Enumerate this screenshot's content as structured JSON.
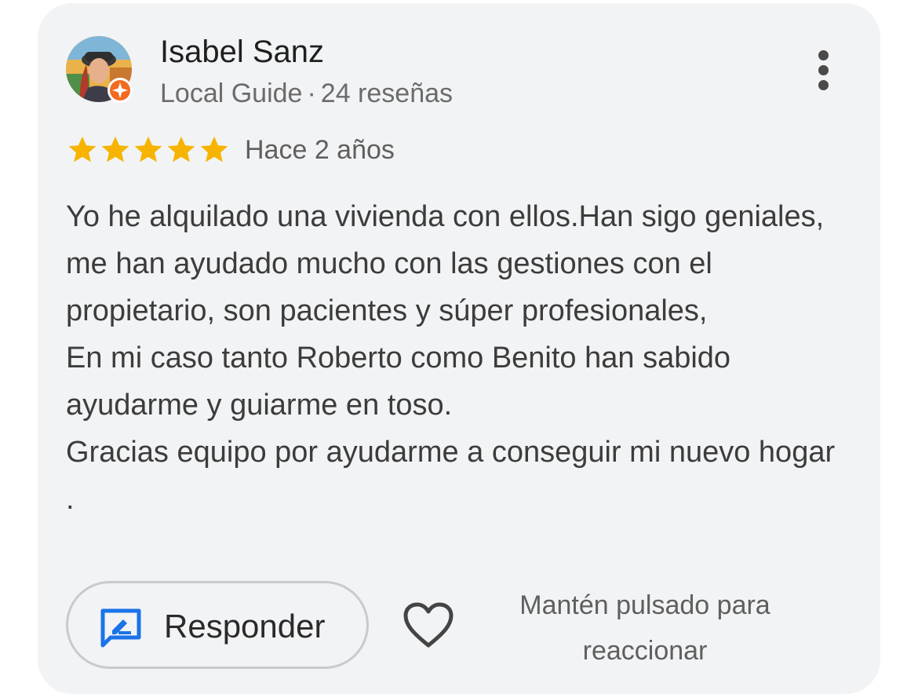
{
  "review": {
    "author": {
      "name": "Isabel Sanz",
      "badge": "Local Guide",
      "separator": "·",
      "review_count": "24 reseñas",
      "avatar_icon": "user-avatar-illustration",
      "guide_badge_icon": "local-guide-star-icon"
    },
    "rating": 5,
    "max_rating": 5,
    "date": "Hace 2 años",
    "text": "Yo he alquilado una vivienda con ellos.Han sigo geniales, me han ayudado mucho con las gestiones con el propietario, son pacientes y súper profesionales,\nEn mi caso tanto Roberto como Benito han sabido ayudarme y guiarme en toso.\nGracias equipo por ayudarme a conseguir mi nuevo hogar .",
    "actions": {
      "reply_label": "Responder",
      "reply_icon": "reply-edit-icon",
      "like_icon": "heart-outline-icon",
      "react_hint": "Mantén pulsado para reaccionar",
      "more_icon": "more-vert-icon"
    }
  },
  "colors": {
    "card_background": "#f2f3f5",
    "star": "#f6b400",
    "reply_icon": "#1a73e8",
    "badge": "#f26b21"
  }
}
